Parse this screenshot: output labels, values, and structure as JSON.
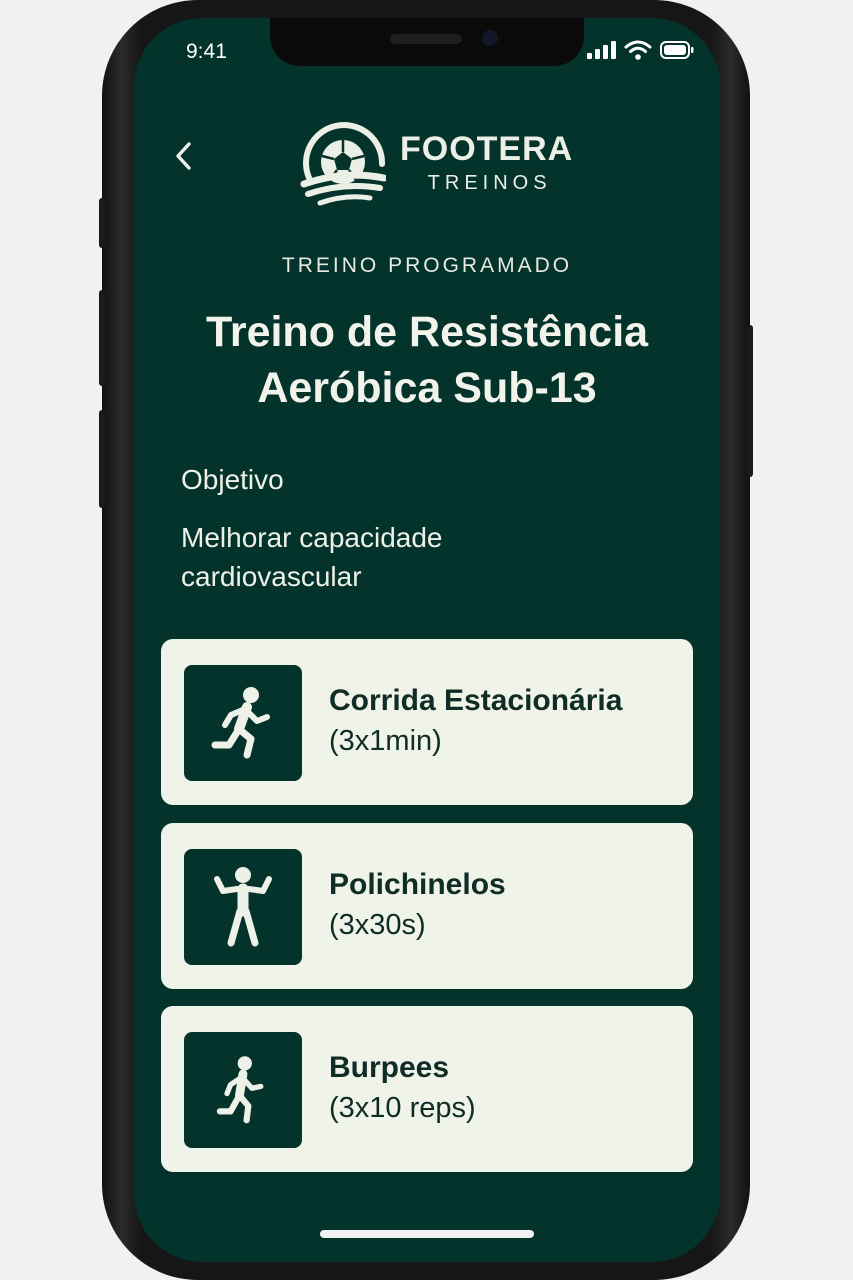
{
  "status_bar": {
    "time": "9:41"
  },
  "header": {
    "back_icon": "chevron-left-icon",
    "logo_icon": "soccer-ball-icon",
    "brand_name": "FOOTERA",
    "brand_sub": "TREINOS"
  },
  "workout": {
    "eyebrow": "TREINO PROGRAMADO",
    "title_line1": "Treino de Resistência",
    "title_line2": "Aeróbica Sub-13",
    "objective_label": "Objetivo",
    "objective_text": "Melhorar capacidade cardiovascular"
  },
  "exercises": [
    {
      "name": "Corrida Estacionária",
      "detail": "(3x1min)",
      "icon": "running-person-icon"
    },
    {
      "name": "Polichinelos",
      "detail": "(3x30s)",
      "icon": "jumping-jack-icon"
    },
    {
      "name": "Burpees",
      "detail": "(3x10 reps)",
      "icon": "running-person-icon"
    }
  ],
  "colors": {
    "screen_bg": "#04332b",
    "card_bg": "#f0f3e8",
    "text_light": "#eef1e8",
    "text_dark": "#0f2c27"
  }
}
